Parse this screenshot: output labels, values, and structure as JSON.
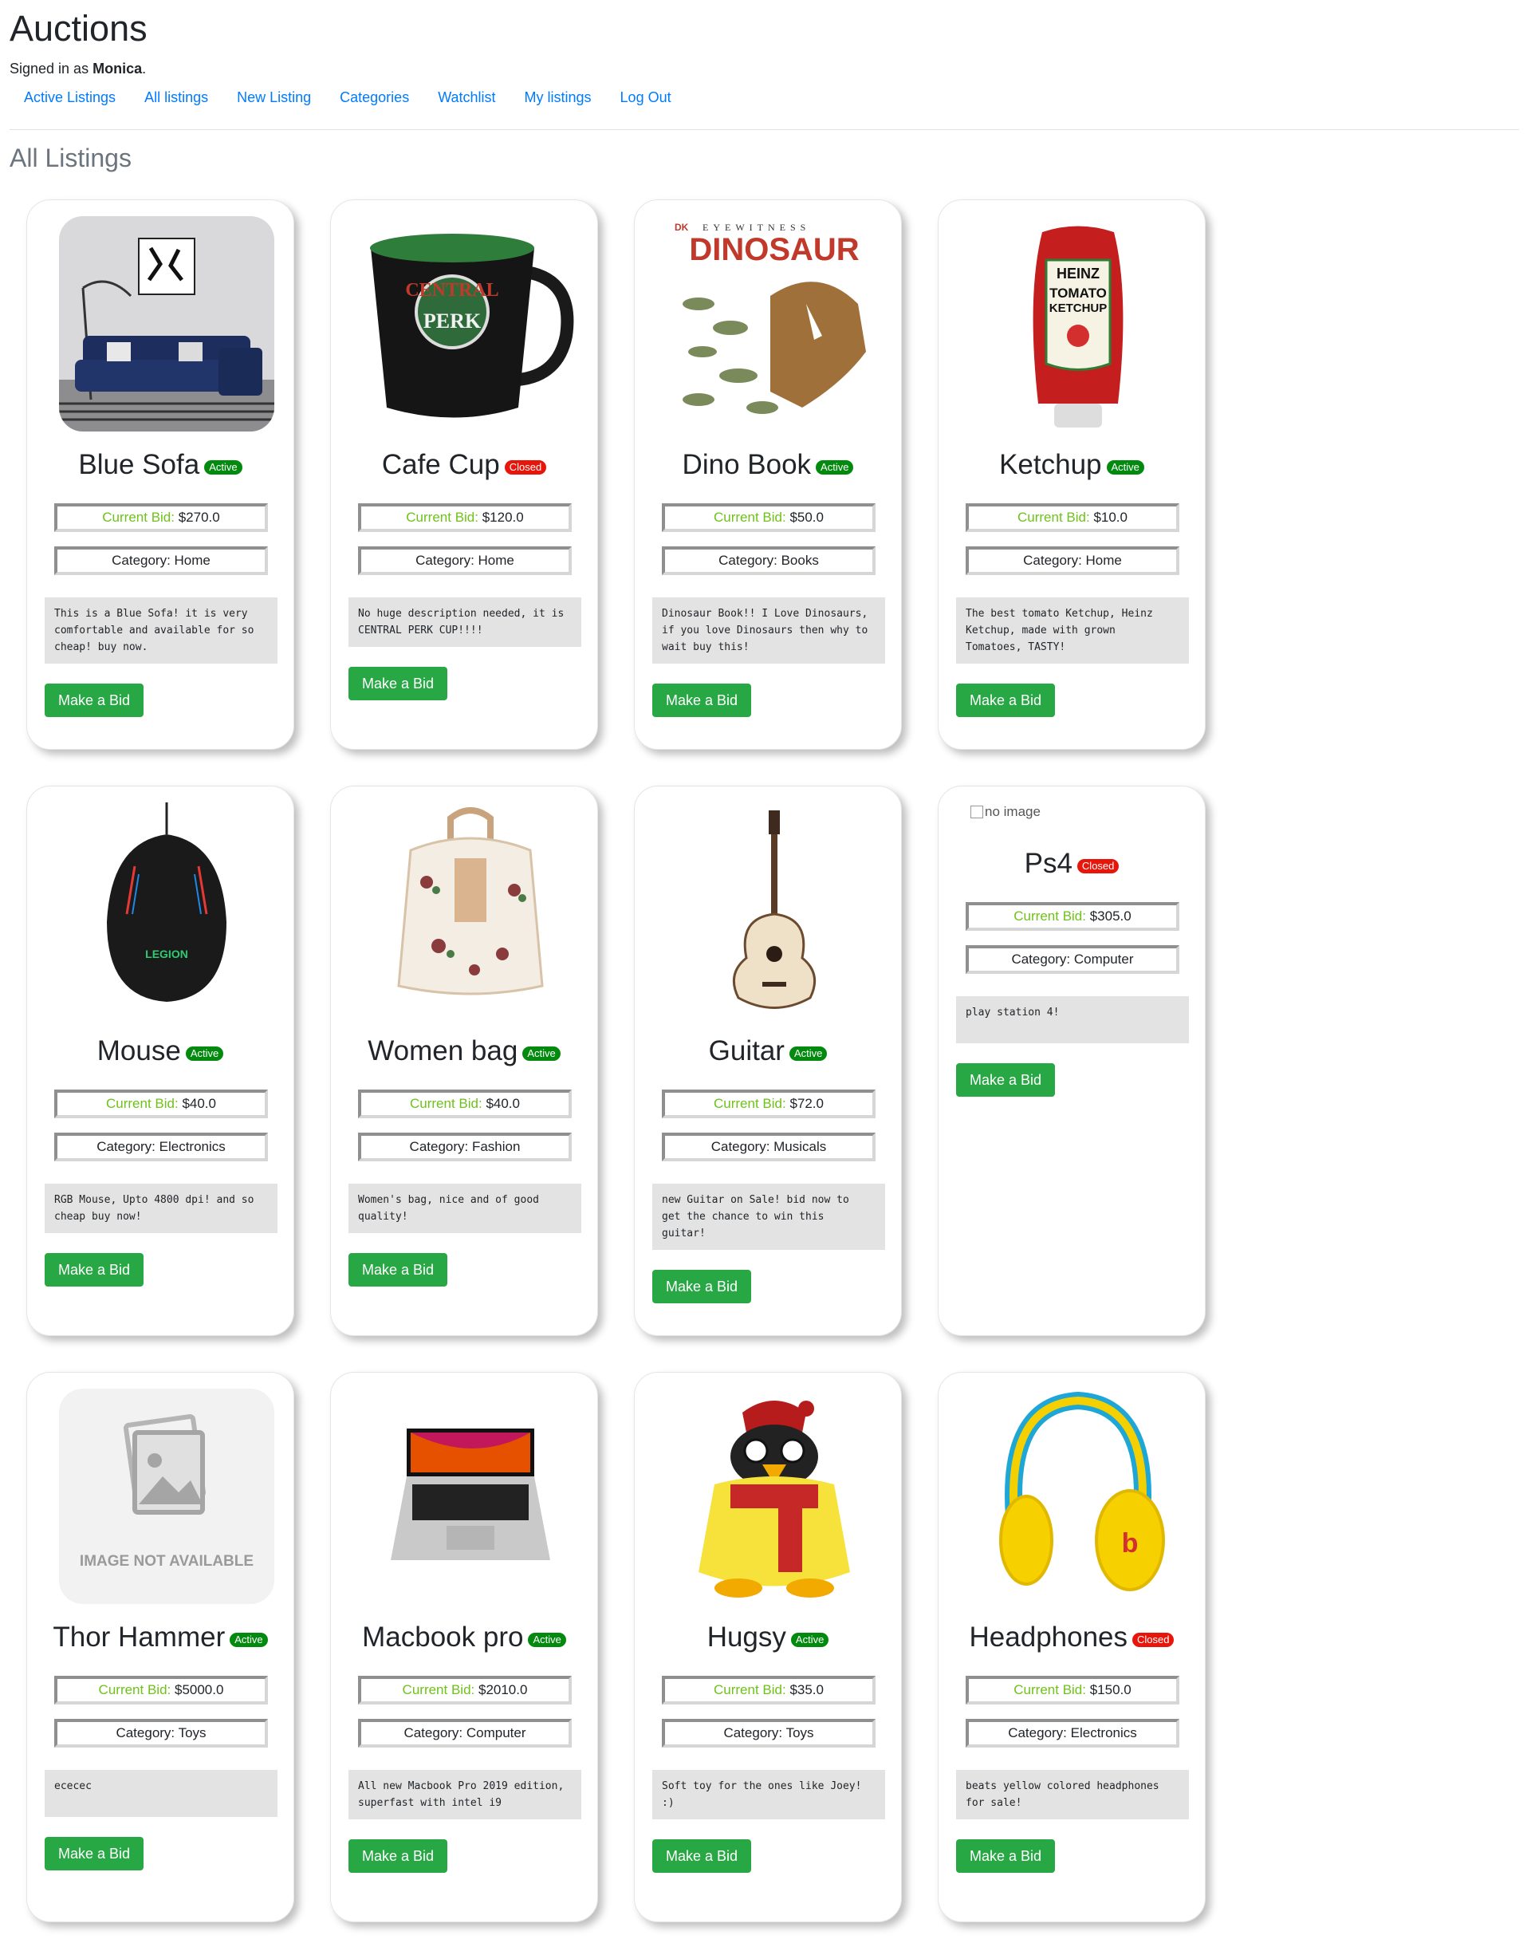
{
  "header": {
    "site_title": "Auctions",
    "signed_in_prefix": "Signed in as ",
    "username": "Monica",
    "signed_in_suffix": ".",
    "nav": [
      "Active Listings",
      "All listings",
      "New Listing",
      "Categories",
      "Watchlist",
      "My listings",
      "Log Out"
    ]
  },
  "page_heading": "All Listings",
  "labels": {
    "current_bid": "Current Bid:",
    "make_bid_button": "Make a Bid",
    "no_image_alt": "no image"
  },
  "colors": {
    "link": "#007bff",
    "active_badge": "#028a0f",
    "closed_badge": "#e8150b",
    "button": "#28a745",
    "bid_label": "#6ec21a",
    "description_bg": "#e3e3e3"
  },
  "listings": [
    {
      "title": "Blue Sofa",
      "status": "Active",
      "bid": "$270.0",
      "category": "Category: Home",
      "description": "This is a Blue Sofa! it is very\ncomfortable and available for so\ncheap! buy now.",
      "image": "sofa-image"
    },
    {
      "title": "Cafe Cup",
      "status": "Closed",
      "bid": "$120.0",
      "category": "Category: Home",
      "description": "No huge description needed, it is\nCENTRAL PERK CUP!!!!",
      "image": "mug-image",
      "image_text": [
        "CENTRAL",
        "PERK"
      ]
    },
    {
      "title": "Dino Book",
      "status": "Active",
      "bid": "$50.0",
      "category": "Category: Books",
      "description": "Dinosaur Book!! I Love Dinosaurs,\nif you love Dinosaurs then why to\nwait buy this!",
      "image": "dinosaur-book-image",
      "image_text": [
        "DK",
        "EYEWITNESS",
        "DINOSAUR"
      ]
    },
    {
      "title": "Ketchup",
      "status": "Active",
      "bid": "$10.0",
      "category": "Category: Home",
      "description": "The best tomato Ketchup, Heinz\nKetchup, made with grown\nTomatoes, TASTY!",
      "image": "ketchup-image",
      "image_text": [
        "HEINZ",
        "TOMATO",
        "KETCHUP"
      ]
    },
    {
      "title": "Mouse",
      "status": "Active",
      "bid": "$40.0",
      "category": "Category: Electronics",
      "description": "RGB Mouse, Upto 4800 dpi! and so\ncheap buy now!",
      "image": "mouse-image",
      "image_text": [
        "LEGION"
      ]
    },
    {
      "title": "Women bag",
      "status": "Active",
      "bid": "$40.0",
      "category": "Category: Fashion",
      "description": "Women's bag, nice and of good\nquality!",
      "image": "bag-image"
    },
    {
      "title": "Guitar",
      "status": "Active",
      "bid": "$72.0",
      "category": "Category: Musicals",
      "description": "new Guitar on Sale! bid now to\nget the chance to win this\nguitar!",
      "image": "guitar-image"
    },
    {
      "title": "Ps4",
      "status": "Closed",
      "bid": "$305.0",
      "category": "Category: Computer",
      "description": "play station 4!",
      "image": "none"
    },
    {
      "title": "Thor Hammer",
      "status": "Active",
      "bid": "$5000.0",
      "category": "Category: Toys",
      "description": "ececec",
      "image": "image-not-available",
      "image_text": [
        "IMAGE NOT AVAILABLE"
      ]
    },
    {
      "title": "Macbook pro",
      "status": "Active",
      "bid": "$2010.0",
      "category": "Category: Computer",
      "description": "All new Macbook Pro 2019 edition,\nsuperfast with intel i9",
      "image": "laptop-image"
    },
    {
      "title": "Hugsy",
      "status": "Active",
      "bid": "$35.0",
      "category": "Category: Toys",
      "description": "Soft toy for the ones like Joey!\n:)",
      "image": "penguin-toy-image"
    },
    {
      "title": "Headphones",
      "status": "Closed",
      "bid": "$150.0",
      "category": "Category: Electronics",
      "description": "beats yellow colored headphones\nfor sale!",
      "image": "headphones-image"
    }
  ]
}
